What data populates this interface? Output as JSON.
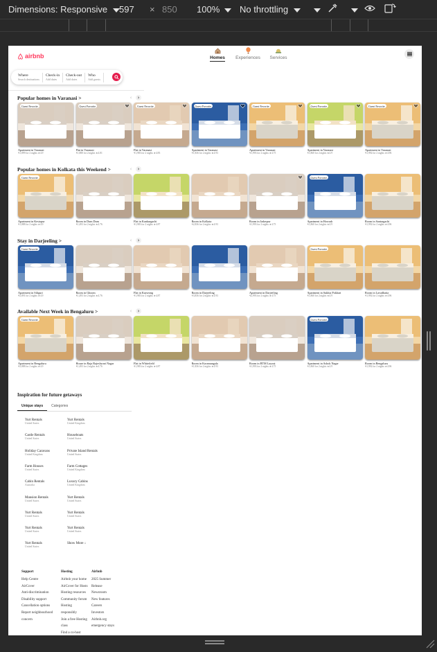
{
  "devtools": {
    "dimensions_label": "Dimensions: Responsive",
    "width": "597",
    "times": "×",
    "height": "850",
    "zoom": "100%",
    "throttling": "No throttling"
  },
  "site": {
    "logo_text": "airbnb",
    "tabs": [
      {
        "label": "Homes",
        "icon": "house-icon"
      },
      {
        "label": "Experiences",
        "icon": "balloon-icon"
      },
      {
        "label": "Services",
        "icon": "bell-icon"
      }
    ],
    "search": {
      "where_label": "Where",
      "where_placeholder": "Search destinations",
      "checkin_label": "Check-in",
      "checkin_placeholder": "Add dates",
      "checkout_label": "Check-out",
      "checkout_placeholder": "Add dates",
      "who_label": "Who",
      "who_placeholder": "Add guests"
    },
    "badge": "Guest Favorite",
    "sections": [
      {
        "title": "Popular homes in Varanasi >",
        "cards": [
          {
            "name": "Apartment in Varanasi",
            "price": "₹1,899 for 2 nights ★4.9"
          },
          {
            "name": "Flat in Varanasi",
            "price": "₹1,880 for 2 nights ★4.81"
          },
          {
            "name": "Flat in Varanasi",
            "price": "₹1,983 for 2 nights ★4.83"
          },
          {
            "name": "Apartment in Varanasi",
            "price": "₹1,836 for 2 nights ★4.93"
          },
          {
            "name": "Apartment in Varanasi",
            "price": "₹1,993 for 2 nights ★4.75"
          },
          {
            "name": "Apartment in Varanasi",
            "price": "₹1,860 for 2 nights ★4.9"
          },
          {
            "name": "Apartment in Varanasi",
            "price": "₹1,992 for 2 nights ★4.96"
          }
        ]
      },
      {
        "title": "Popular homes in Kolkata this Weekend >",
        "cards": [
          {
            "name": "Apartment in Kestopur",
            "price": "₹1,888 for 2 nights ★4.9"
          },
          {
            "name": "Room in Dum Dum",
            "price": "₹1,493 for 2 nights ★4.76"
          },
          {
            "name": "Flat in Kankurgachi",
            "price": "₹1,983 for 2 nights ★4.87"
          },
          {
            "name": "Room in Kolkata",
            "price": "₹2,836 for 2 nights ★4.93"
          },
          {
            "name": "Room in Jadavpur",
            "price": "₹1,993 for 2 nights ★4.75"
          },
          {
            "name": "Apartment in Howrah",
            "price": "₹1,860 for 2 nights ★4.9"
          },
          {
            "name": "Room in Santragachi",
            "price": "₹1,992 for 2 nights ★4.96"
          }
        ]
      },
      {
        "title": "Stay in Darjeeling >",
        "cards": [
          {
            "name": "Apartment in Siliguri",
            "price": "₹3,891 for 2 nights ★4.9"
          },
          {
            "name": "Room in Ghoom",
            "price": "₹1,493 for 2 nights ★4.76"
          },
          {
            "name": "Flat in Kurseong",
            "price": "₹1,983 for 2 nights ★4.87"
          },
          {
            "name": "Room in Darjeeling",
            "price": "₹3,836 for 2 nights ★4.93"
          },
          {
            "name": "Apartment in Darjeeling",
            "price": "₹2,993 for 2 nights ★4.75"
          },
          {
            "name": "Apartment in Sukhia Pokhari",
            "price": "₹1,860 for 2 nights ★4.9"
          },
          {
            "name": "Room in Lavadhatta",
            "price": "₹1,992 for 2 nights ★4.96"
          }
        ]
      },
      {
        "title": "Available Next Week in Bengaluru >",
        "cards": [
          {
            "name": "Apartment in Bengaluru",
            "price": "₹3,888 for 2 nights ★4.9"
          },
          {
            "name": "House in Raja Rajeshwari Nagar",
            "price": "₹1,493 for 2 nights ★4.76"
          },
          {
            "name": "Flat in Whitefield",
            "price": "₹1,983 for 2 nights ★4.87"
          },
          {
            "name": "Room in Koramangala",
            "price": "₹1,836 for 2 nights ★4.93"
          },
          {
            "name": "Room in BTM Layout",
            "price": "₹1,993 for 2 nights ★4.75"
          },
          {
            "name": "Apartment in Ashok Nagar",
            "price": "₹1,860 for 2 nights ★4.9"
          },
          {
            "name": "Room in Bengaluru",
            "price": "₹1,992 for 2 nights ★4.96"
          }
        ]
      }
    ],
    "inspiration": {
      "title": "Inspiration for future getaways",
      "tabs": [
        "Unique stays",
        "Categories"
      ],
      "left": [
        {
          "name": "Yurt Rentals",
          "loc": "United States"
        },
        {
          "name": "Castle Rentals",
          "loc": "United States"
        },
        {
          "name": "Holiday Caravans",
          "loc": "United Kingdom"
        },
        {
          "name": "Farm Houses",
          "loc": "United States"
        },
        {
          "name": "Cabin Rentals",
          "loc": "Australia"
        },
        {
          "name": "Mansion Rentals",
          "loc": "United States"
        },
        {
          "name": "Yurt Rentals",
          "loc": "United States"
        },
        {
          "name": "Yurt Rentals",
          "loc": "United States"
        },
        {
          "name": "Yurt Rentals",
          "loc": "United States"
        }
      ],
      "right": [
        {
          "name": "Yurt Rentals",
          "loc": "United Kingdom"
        },
        {
          "name": "Houseboats",
          "loc": "United States"
        },
        {
          "name": "Private Island Rentals",
          "loc": "United States"
        },
        {
          "name": "Farm Cottages",
          "loc": "United Kingdom"
        },
        {
          "name": "Luxury Cabins",
          "loc": "United Kingdom"
        },
        {
          "name": "Yurt Rentals",
          "loc": "United States"
        },
        {
          "name": "Yurt Rentals",
          "loc": "United States"
        },
        {
          "name": "Yurt Rentals",
          "loc": "United States"
        }
      ],
      "show_more": "Show More ↓"
    },
    "footer": {
      "support": {
        "title": "Support",
        "lines": [
          "Help Centre",
          "AirCover",
          "Anti-discrimination",
          "Disability support",
          "Cancellation options",
          "Report neighbourhood",
          "concern"
        ]
      },
      "hosting": {
        "title": "Hosting",
        "lines": [
          "Airbnb your home",
          "AirCover for Hosts",
          "Hosting resources",
          "Community forum",
          "Hosting",
          "responsibly",
          "Join a free Hosting",
          "class",
          "Find a co-host"
        ]
      },
      "airbnb": {
        "title": "Airbnb",
        "lines": [
          "2025 Summer",
          "Release",
          "Newsroom",
          "New features",
          "Careers",
          "Investors",
          "Airbnb.org",
          "emergency stays"
        ]
      }
    }
  },
  "colors": {
    "brand": "#ff385c",
    "search_button": "#e51d4d"
  }
}
